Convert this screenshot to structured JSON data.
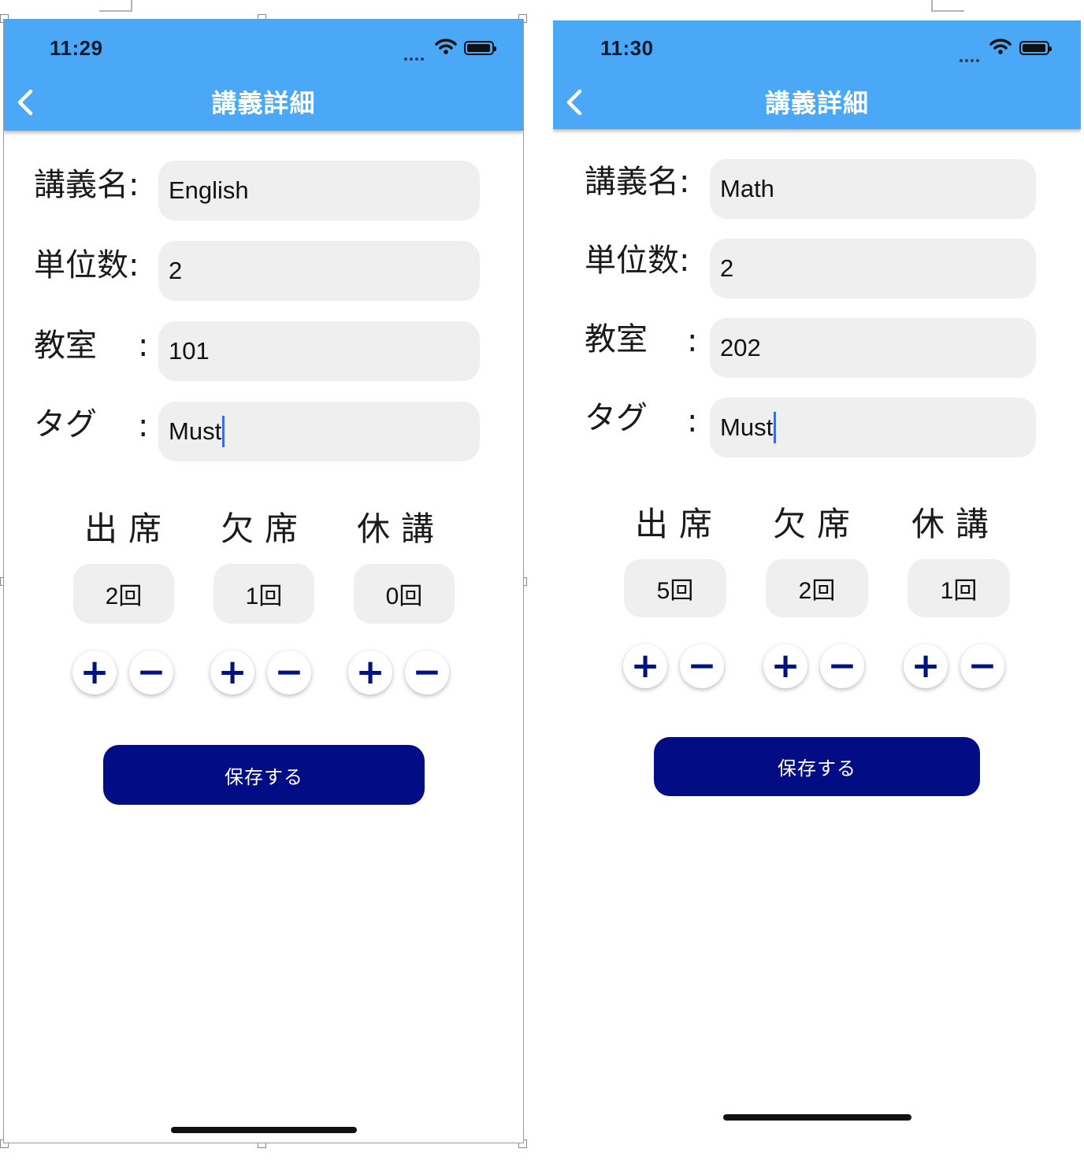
{
  "screens": [
    {
      "time": "11:29",
      "title": "講義詳細",
      "fields": [
        {
          "label": "講義名:",
          "colon": "",
          "value": "English",
          "caret": false
        },
        {
          "label": "単位数:",
          "colon": "",
          "value": "2",
          "caret": false
        },
        {
          "label": "教室",
          "colon": ":",
          "value": "101",
          "caret": false
        },
        {
          "label": "タグ",
          "colon": ":",
          "value": "Must",
          "caret": true
        }
      ],
      "columns": [
        {
          "header": "出席",
          "count": "2回"
        },
        {
          "header": "欠席",
          "count": "1回"
        },
        {
          "header": "休講",
          "count": "0回"
        }
      ],
      "plus_label": "+",
      "minus_label": "−",
      "save_label": "保存する"
    },
    {
      "time": "11:30",
      "title": "講義詳細",
      "fields": [
        {
          "label": "講義名:",
          "colon": "",
          "value": "Math",
          "caret": false
        },
        {
          "label": "単位数:",
          "colon": "",
          "value": "2",
          "caret": false
        },
        {
          "label": "教室",
          "colon": ":",
          "value": "202",
          "caret": false
        },
        {
          "label": "タグ",
          "colon": ":",
          "value": "Must",
          "caret": true
        }
      ],
      "columns": [
        {
          "header": "出席",
          "count": "5回"
        },
        {
          "header": "欠席",
          "count": "2回"
        },
        {
          "header": "休講",
          "count": "1回"
        }
      ],
      "plus_label": "+",
      "minus_label": "−",
      "save_label": "保存する"
    }
  ],
  "colors": {
    "nav_bar": "#4aa8f6",
    "save_button": "#020d85",
    "stepper_icon": "#00127e",
    "field_bg": "#efefef"
  },
  "icons": [
    "back-chevron-icon",
    "signal-dots-icon",
    "wifi-icon",
    "battery-icon",
    "plus-icon",
    "minus-icon"
  ]
}
